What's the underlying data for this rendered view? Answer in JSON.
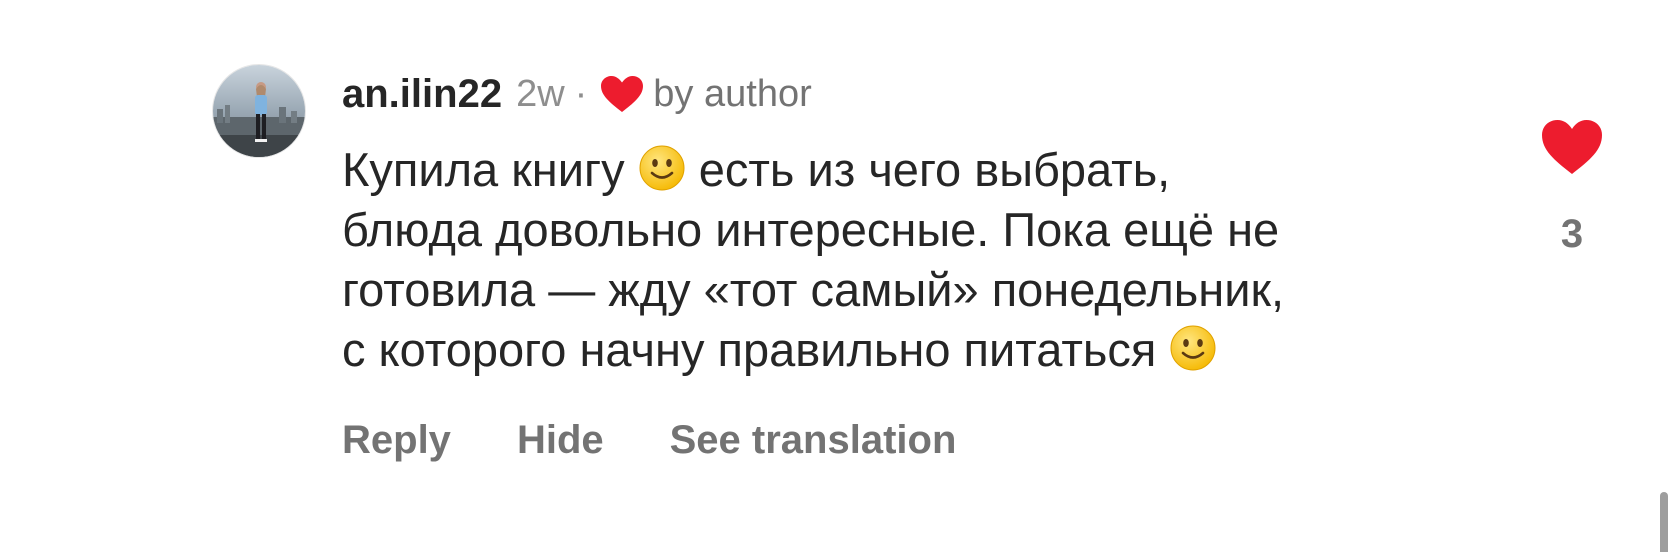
{
  "comment": {
    "username": "an.ilin22",
    "time": "2w",
    "separator": "·",
    "by_author": "by author",
    "body_lines": [
      {
        "before": "Купила книгу ",
        "emoji": "slightly-smiling-face",
        "after": " есть из чего выбрать,"
      },
      {
        "text": "блюда довольно интересные. Пока ещё не"
      },
      {
        "text": "готовила — жду «тот самый» понедельник,"
      },
      {
        "before": "с которого начну правильно питаться ",
        "emoji": "slightly-smiling-face"
      }
    ],
    "actions": {
      "reply": "Reply",
      "hide": "Hide",
      "see_translation": "See translation"
    },
    "likes": {
      "count": "3",
      "liked": true,
      "icon": "heart-icon",
      "color": "#ed1c2e"
    }
  },
  "colors": {
    "text_primary": "#262626",
    "text_secondary": "#737373",
    "heart_red": "#ed1c2e",
    "background": "#ffffff"
  }
}
